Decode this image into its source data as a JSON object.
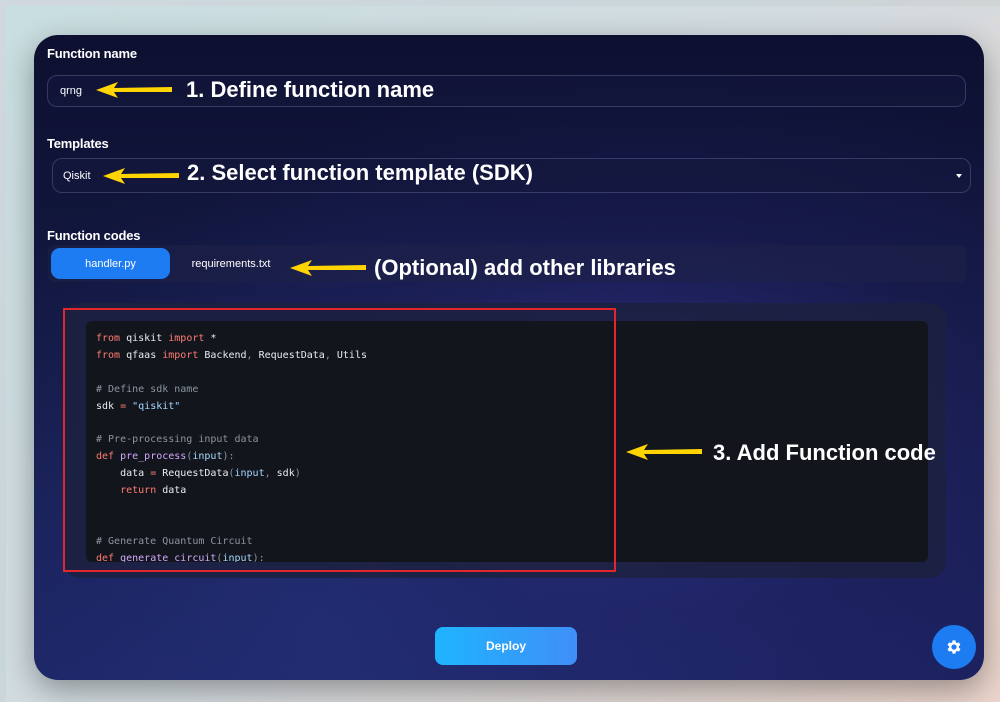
{
  "form": {
    "function_name_label": "Function name",
    "function_name_value": "qrng",
    "templates_label": "Templates",
    "template_value": "Qiskit",
    "function_codes_label": "Function codes"
  },
  "tabs": [
    {
      "label": "handler.py",
      "active": true
    },
    {
      "label": "requirements.txt",
      "active": false
    }
  ],
  "code_lines": [
    [
      {
        "t": "kw",
        "v": "from"
      },
      {
        "t": "tx",
        "v": " qiskit "
      },
      {
        "t": "kw",
        "v": "import"
      },
      {
        "t": "tx",
        "v": " *"
      }
    ],
    [
      {
        "t": "kw",
        "v": "from"
      },
      {
        "t": "tx",
        "v": " qfaas "
      },
      {
        "t": "kw",
        "v": "import"
      },
      {
        "t": "tx",
        "v": " Backend"
      },
      {
        "t": "pn",
        "v": ","
      },
      {
        "t": "tx",
        "v": " RequestData"
      },
      {
        "t": "pn",
        "v": ","
      },
      {
        "t": "tx",
        "v": " Utils"
      }
    ],
    [],
    [
      {
        "t": "cm",
        "v": "# Define sdk name"
      }
    ],
    [
      {
        "t": "tx",
        "v": "sdk "
      },
      {
        "t": "kw",
        "v": "="
      },
      {
        "t": "tx",
        "v": " "
      },
      {
        "t": "st",
        "v": "\"qiskit\""
      }
    ],
    [],
    [
      {
        "t": "cm",
        "v": "# Pre-processing input data"
      }
    ],
    [
      {
        "t": "kw",
        "v": "def"
      },
      {
        "t": "tx",
        "v": " "
      },
      {
        "t": "fn",
        "v": "pre_process"
      },
      {
        "t": "pn",
        "v": "("
      },
      {
        "t": "st",
        "v": "input"
      },
      {
        "t": "pn",
        "v": "):"
      }
    ],
    [
      {
        "t": "tx",
        "v": "    data "
      },
      {
        "t": "kw",
        "v": "="
      },
      {
        "t": "tx",
        "v": " RequestData"
      },
      {
        "t": "pn",
        "v": "("
      },
      {
        "t": "st",
        "v": "input"
      },
      {
        "t": "pn",
        "v": ","
      },
      {
        "t": "tx",
        "v": " sdk"
      },
      {
        "t": "pn",
        "v": ")"
      }
    ],
    [
      {
        "t": "tx",
        "v": "    "
      },
      {
        "t": "kw",
        "v": "return"
      },
      {
        "t": "tx",
        "v": " data"
      }
    ],
    [],
    [],
    [
      {
        "t": "cm",
        "v": "# Generate Quantum Circuit"
      }
    ],
    [
      {
        "t": "kw",
        "v": "def"
      },
      {
        "t": "tx",
        "v": " "
      },
      {
        "t": "fn",
        "v": "generate_circuit"
      },
      {
        "t": "pn",
        "v": "("
      },
      {
        "t": "st",
        "v": "input"
      },
      {
        "t": "pn",
        "v": "):"
      }
    ]
  ],
  "deploy_label": "Deploy",
  "annotations": {
    "step1": "1. Define function name",
    "step2": "2. Select function template (SDK)",
    "optional": "(Optional) add other libraries",
    "step3": "3. Add Function code"
  },
  "icons": {
    "settings": "gear-icon",
    "dropdown": "caret-down-icon",
    "arrow": "arrow-left-icon"
  },
  "colors": {
    "accent": "#1d7cf2",
    "annotation_arrow": "#ffd400",
    "highlight_box": "#e2262c"
  }
}
